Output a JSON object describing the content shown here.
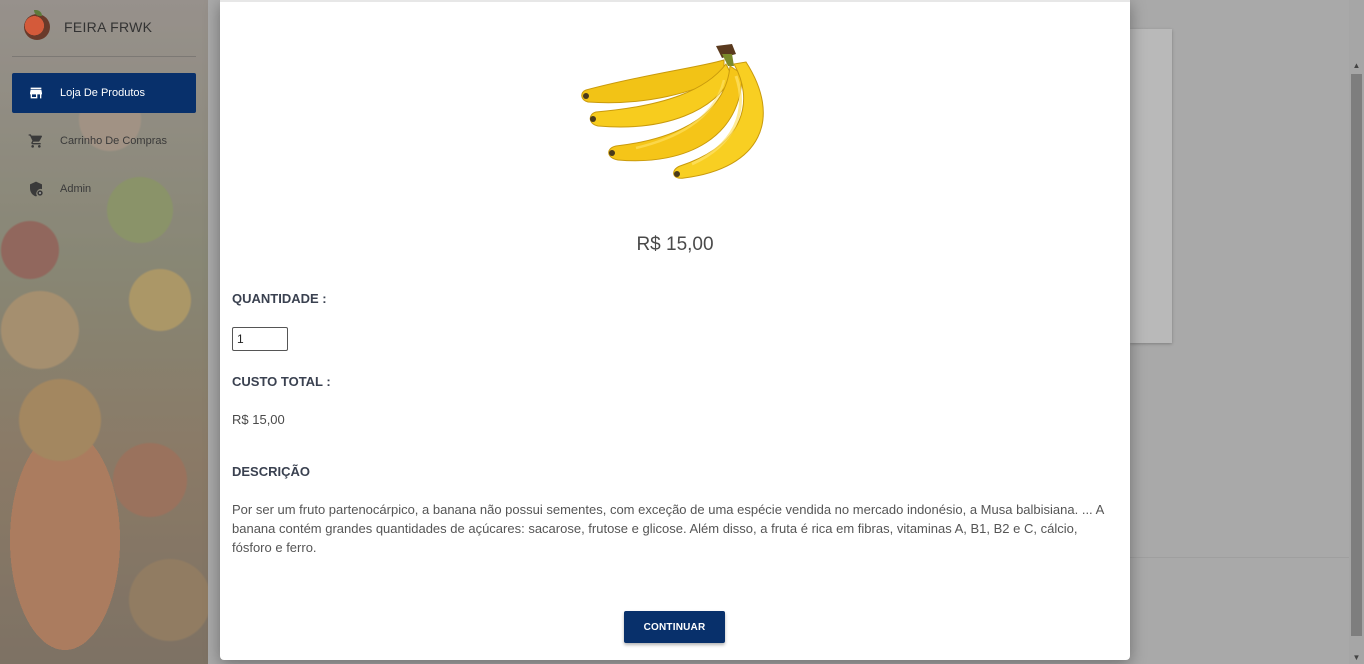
{
  "app": {
    "brand_name": "FEIRA FRWK"
  },
  "sidebar": {
    "items": [
      {
        "label": "Loja De Produtos",
        "icon": "store-icon",
        "active": true
      },
      {
        "label": "Carrinho De Compras",
        "icon": "cart-icon",
        "active": false
      },
      {
        "label": "Admin",
        "icon": "admin-shield-icon",
        "active": false
      }
    ]
  },
  "modal": {
    "product_image": "banana-image",
    "price": "R$ 15,00",
    "quantity_label": "QUANTIDADE :",
    "quantity_value": "1",
    "total_label": "CUSTO TOTAL :",
    "total_value": "R$ 15,00",
    "description_label": "DESCRIÇÃO",
    "description_text": "Por ser um fruto partenocárpico, a banana não possui sementes, com exceção de uma espécie vendida no mercado indonésio, a Musa balbisiana. ... A banana contém grandes quantidades de açúcares: sacarose, frutose e glicose. Além disso, a fruta é rica em fibras, vitaminas A, B1, B2 e C, cálcio, fósforo e ferro.",
    "continue_label": "CONTINUAR"
  },
  "colors": {
    "primary": "#08306b",
    "overlay": "#a9a9a9",
    "banana_yellow": "#f5c518"
  }
}
